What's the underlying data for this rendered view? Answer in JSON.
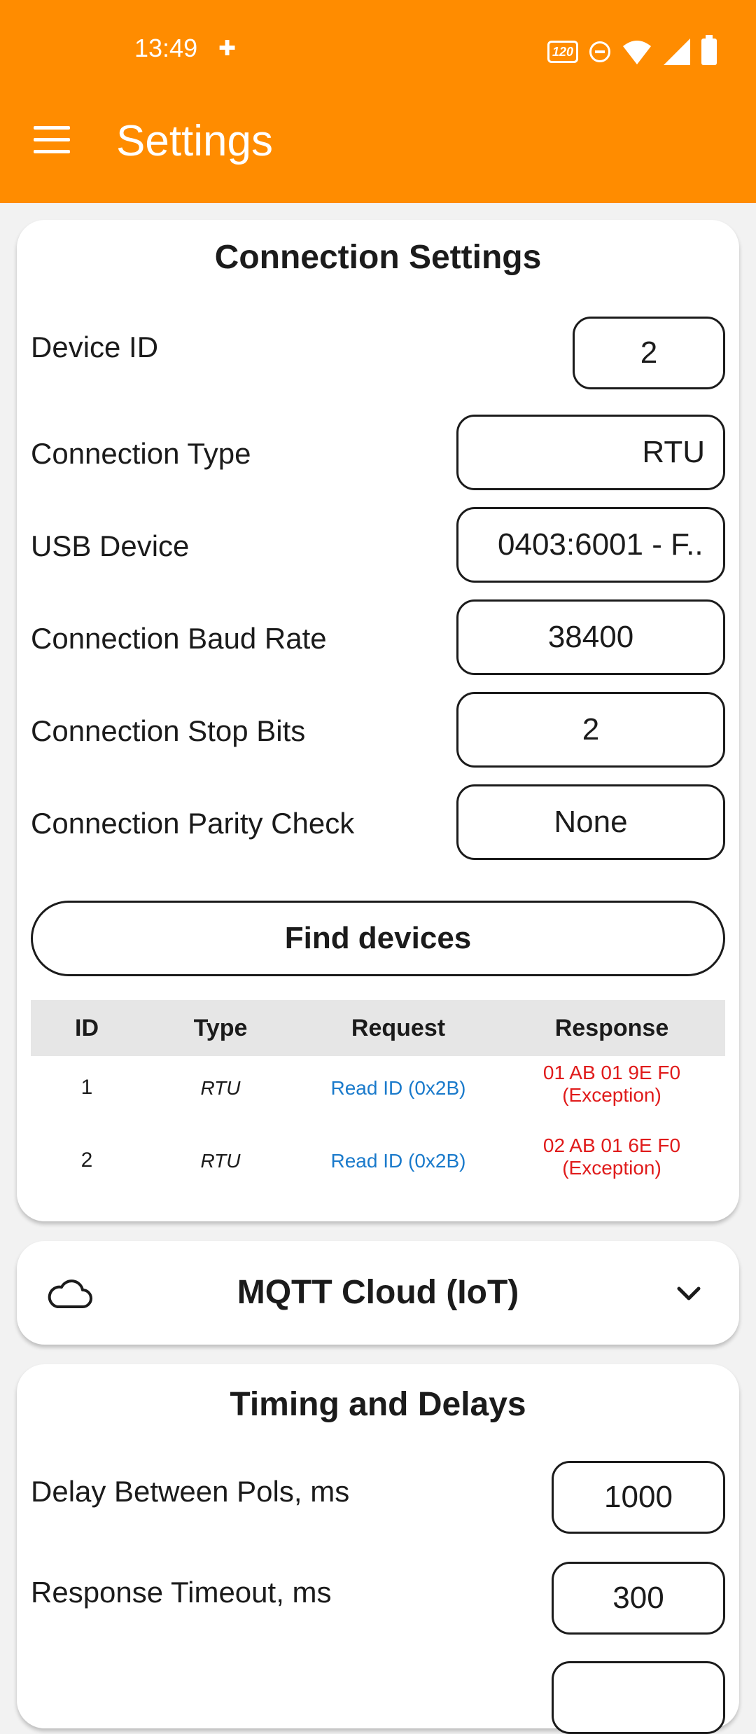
{
  "status_bar": {
    "time": "13:49",
    "hz_label": "120"
  },
  "app_bar": {
    "title": "Settings",
    "accent_color": "#ff8c00"
  },
  "connection": {
    "title": "Connection Settings",
    "device_id_label": "Device ID",
    "device_id_value": "2",
    "connection_type_label": "Connection Type",
    "connection_type_value": "RTU",
    "usb_device_label": "USB Device",
    "usb_device_value": "0403:6001 - F..",
    "baud_rate_label": "Connection Baud Rate",
    "baud_rate_value": "38400",
    "stop_bits_label": "Connection Stop Bits",
    "stop_bits_value": "2",
    "parity_label": "Connection Parity Check",
    "parity_value": "None",
    "find_button": "Find devices",
    "table": {
      "headers": [
        "ID",
        "Type",
        "Request",
        "Response"
      ],
      "rows": [
        {
          "id": "1",
          "type": "RTU",
          "request": "Read ID (0x2B)",
          "response_line1": "01 AB 01 9E F0",
          "response_line2": "(Exception)"
        },
        {
          "id": "2",
          "type": "RTU",
          "request": "Read ID (0x2B)",
          "response_line1": "02 AB 01 6E F0",
          "response_line2": "(Exception)"
        }
      ]
    }
  },
  "mqtt": {
    "title": "MQTT Cloud (IoT)",
    "icon": "cloud-icon",
    "expand_icon": "chevron-down-icon"
  },
  "timing": {
    "title": "Timing and Delays",
    "delay_label": "Delay Between Pols, ms",
    "delay_value": "1000",
    "timeout_label": "Response Timeout, ms",
    "timeout_value": "300"
  }
}
